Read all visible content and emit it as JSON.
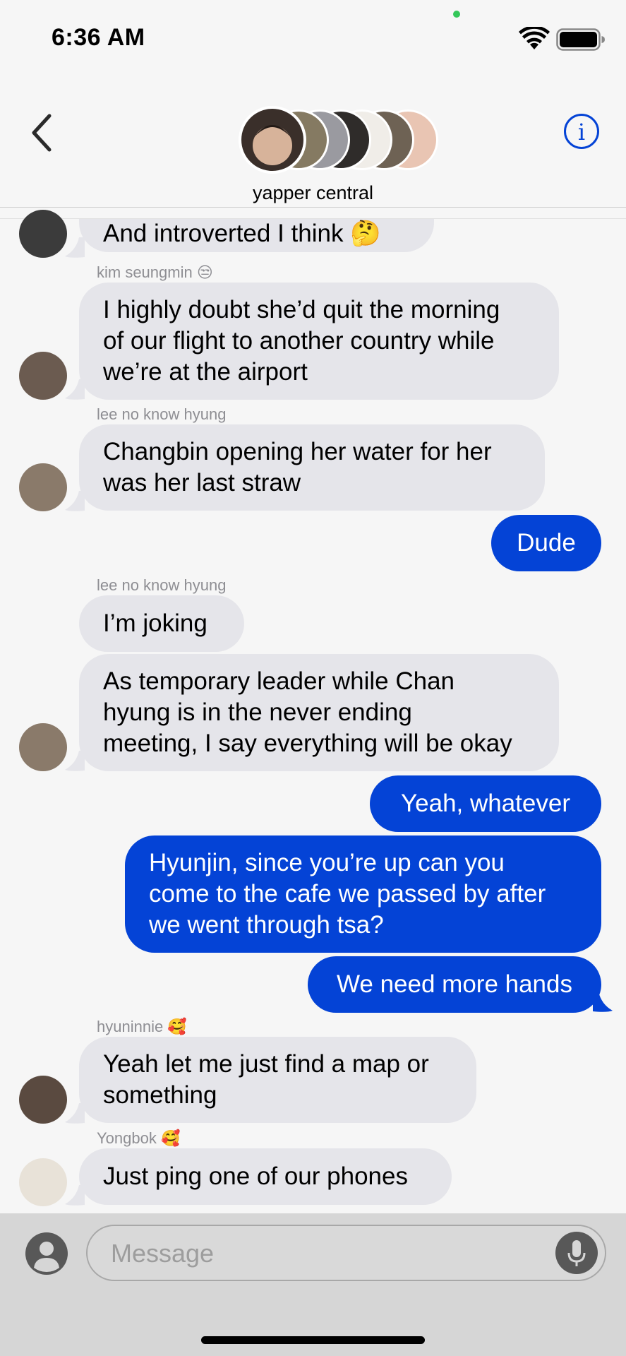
{
  "status_bar": {
    "time": "6:36 AM"
  },
  "header": {
    "group_name": "yapper central"
  },
  "messages": {
    "m0": {
      "text": "And introverted I think 🤔"
    },
    "m1": {
      "sender": "kim seungmin 😒",
      "text": [
        "I highly doubt she’d quit the morning",
        "of our flight to another country while",
        "we’re at the airport"
      ]
    },
    "m2": {
      "sender": "lee no know hyung",
      "text": [
        "Changbin opening her water for her",
        "was her last straw"
      ]
    },
    "m3": {
      "text": "Dude"
    },
    "m4": {
      "sender": "lee no know hyung",
      "text": "I’m joking"
    },
    "m5": {
      "text": [
        "As temporary leader while Chan",
        "hyung is in the never ending",
        "meeting, I say everything will be okay"
      ]
    },
    "m6": {
      "text": "Yeah, whatever"
    },
    "m7": {
      "text": [
        "Hyunjin, since you’re up can you",
        "come to the cafe we passed by after",
        "we went through tsa?"
      ]
    },
    "m8": {
      "text": "We need more hands"
    },
    "m9": {
      "sender": "hyuninnie 🥰",
      "text": [
        "Yeah let me just find a map or",
        "something"
      ]
    },
    "m10": {
      "sender": "Yongbok 🥰",
      "text": "Just ping one of our phones"
    }
  },
  "input": {
    "placeholder": "Message"
  },
  "colors": {
    "outgoing": "#0443d6",
    "incoming": "#e5e5ea",
    "accent": "#0443d6"
  }
}
